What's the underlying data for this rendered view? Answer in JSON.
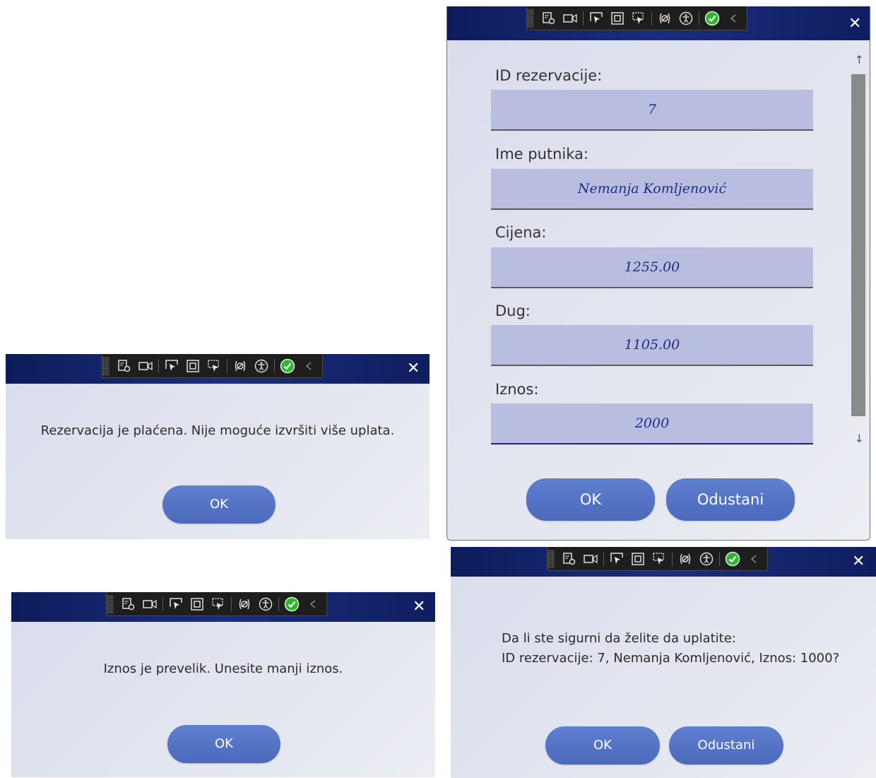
{
  "dialog_payment_blocked": {
    "message": "Rezervacija je plaćena. Nije moguće izvršiti više uplata.",
    "ok_label": "OK",
    "close_glyph": "✕"
  },
  "dialog_payment_form": {
    "close_glyph": "✕",
    "fields": [
      {
        "label": "ID rezervacije:",
        "value": "7"
      },
      {
        "label": "Ime putnika:",
        "value": "Nemanja Komljenović"
      },
      {
        "label": "Cijena:",
        "value": "1255.00"
      },
      {
        "label": "Dug:",
        "value": "1105.00"
      },
      {
        "label": "Iznos:",
        "value": "2000"
      }
    ],
    "ok_label": "OK",
    "cancel_label": "Odustani",
    "scroll_up_glyph": "↑",
    "scroll_down_glyph": "↓"
  },
  "dialog_amount_too_large": {
    "message": "Iznos je prevelik. Unesite manji iznos.",
    "ok_label": "OK",
    "close_glyph": "✕"
  },
  "dialog_confirm": {
    "message_line1": "Da li ste sigurni da želite da uplatite:",
    "message_line2": "ID rezervacije: 7, Nemanja Komljenović, Iznos: 1000?",
    "ok_label": "OK",
    "cancel_label": "Odustani",
    "close_glyph": "✕"
  },
  "debug_toolbar": {
    "icons": [
      "live-visual-tree-icon",
      "record-icon",
      "select-element-icon",
      "display-layout-adorners-icon",
      "track-focus-icon",
      "binding-failures-icon",
      "accessibility-icon",
      "checkmark-icon",
      "collapse-chevron-icon"
    ],
    "accent_check_color": "#2eb82e"
  },
  "colors": {
    "titlebar": "#13236b",
    "field_bg": "#b9bde0",
    "button": "#5473c5",
    "value_text": "#1f2f80"
  }
}
